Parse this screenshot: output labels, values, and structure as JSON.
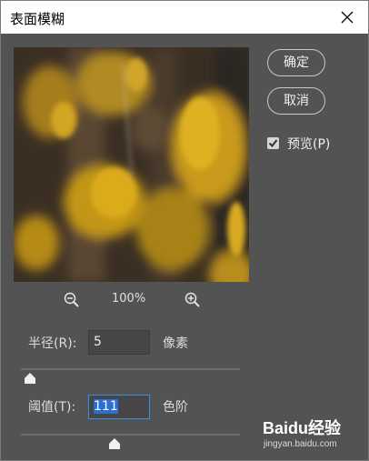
{
  "window": {
    "title": "表面模糊"
  },
  "buttons": {
    "ok": "确定",
    "cancel": "取消"
  },
  "preview": {
    "label": "预览(P)",
    "checked": true
  },
  "zoom": {
    "level": "100%"
  },
  "radius": {
    "label": "半径(R):",
    "value": "5",
    "unit": "像素",
    "slider_fraction": 0.04
  },
  "threshold": {
    "label": "阈值(T):",
    "value": "111",
    "unit": "色阶",
    "slider_fraction": 0.43
  },
  "watermark": {
    "logo": "Baidu经验",
    "url": "jingyan.baidu.com"
  },
  "colors": {
    "dialog_bg": "#535353",
    "selection": "#2b6fd6",
    "preview_foliage": "#d4a21c"
  }
}
